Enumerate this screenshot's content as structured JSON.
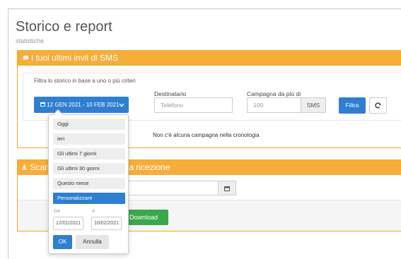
{
  "page": {
    "title": "Storico e report",
    "subtitle": "statistiche"
  },
  "sms_panel": {
    "heading_icon": "comment-icon",
    "heading": "i tuoi ultimi invii di SMS",
    "filter_text": "Filtra lo storico in base a uno o più criteri",
    "date_range_label": "12 GEN 2021 - 10 FEB 2021",
    "recipient_label": "Destinatario",
    "recipient_placeholder": "Telefono",
    "campaign_label": "Campagna da più di",
    "campaign_value": "100",
    "campaign_addon": "SMS",
    "filter_button": "Filtra",
    "refresh_icon": "refresh-icon",
    "empty_message": "Non c'è alcuna campagna nella cronologia"
  },
  "download_panel": {
    "heading_icon": "download-icon",
    "heading_left": "Scari",
    "heading_right": "nuta ricezione",
    "download_button": "Download"
  },
  "date_picker": {
    "ranges": [
      {
        "label": "Oggi",
        "active": false
      },
      {
        "label": "ieri",
        "active": false
      },
      {
        "label": "Gli ultimi 7 giorni",
        "active": false
      },
      {
        "label": "Gli ultimi 30 giorni",
        "active": false
      },
      {
        "label": "Questo mese",
        "active": false
      },
      {
        "label": "Personalizzare",
        "active": true
      }
    ],
    "from_label": "DA",
    "to_label": "A",
    "from_value": "12/01/2021",
    "to_value": "10/02/2021",
    "ok_button": "OK",
    "cancel_button": "Annulla"
  },
  "colors": {
    "accent_orange": "#f6ad3a",
    "primary_blue": "#2f7fd1",
    "success_green": "#3aa84a"
  }
}
